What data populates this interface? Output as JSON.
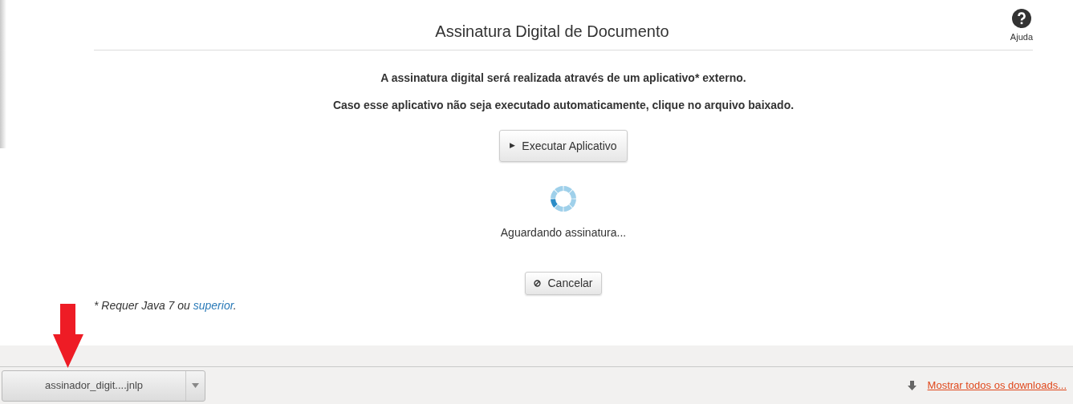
{
  "header": {
    "title": "Assinatura Digital de Documento",
    "help": {
      "label": "Ajuda"
    }
  },
  "messages": [
    "A assinatura digital será realizada através de um aplicativo* externo.",
    "Caso esse aplicativo não seja executado automaticamente, clique no arquivo baixado."
  ],
  "run_button": {
    "icon": "▶",
    "label": "Executar Aplicativo"
  },
  "status": "Aguardando assinatura...",
  "cancel_button": {
    "label": "Cancelar"
  },
  "footnote": {
    "text": "* Requer Java 7 ou ",
    "link": "superior",
    "after": "."
  },
  "download_bar": {
    "file": "assinador_digit....jnlp",
    "show_all": "Mostrar todos os downloads..."
  }
}
